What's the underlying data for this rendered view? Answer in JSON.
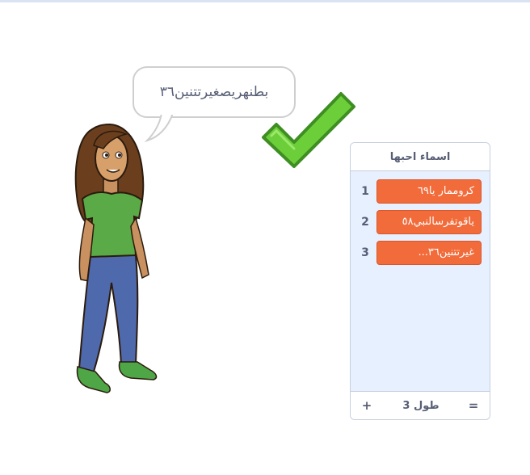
{
  "speech_bubble": {
    "text": "بطنهريصغيرتتنين٣٦"
  },
  "list_monitor": {
    "title": "اسماء احبها",
    "items": [
      {
        "index": "1",
        "value": "كروممار يا٦٩"
      },
      {
        "index": "2",
        "value": "ياقوتفرسالنبي٥٨"
      },
      {
        "index": "3",
        "value": "غيرتتنين٣٦..."
      }
    ],
    "footer": {
      "add_label": "+",
      "length_label": "طول 3",
      "resize_label": "="
    }
  },
  "colors": {
    "item_background": "#f26b3a",
    "monitor_background": "#e6f0ff",
    "check_green": "#6ccf3a",
    "text": "#575e75"
  },
  "icons": {
    "check": "check-mark-icon",
    "sprite": "girl-sprite"
  }
}
